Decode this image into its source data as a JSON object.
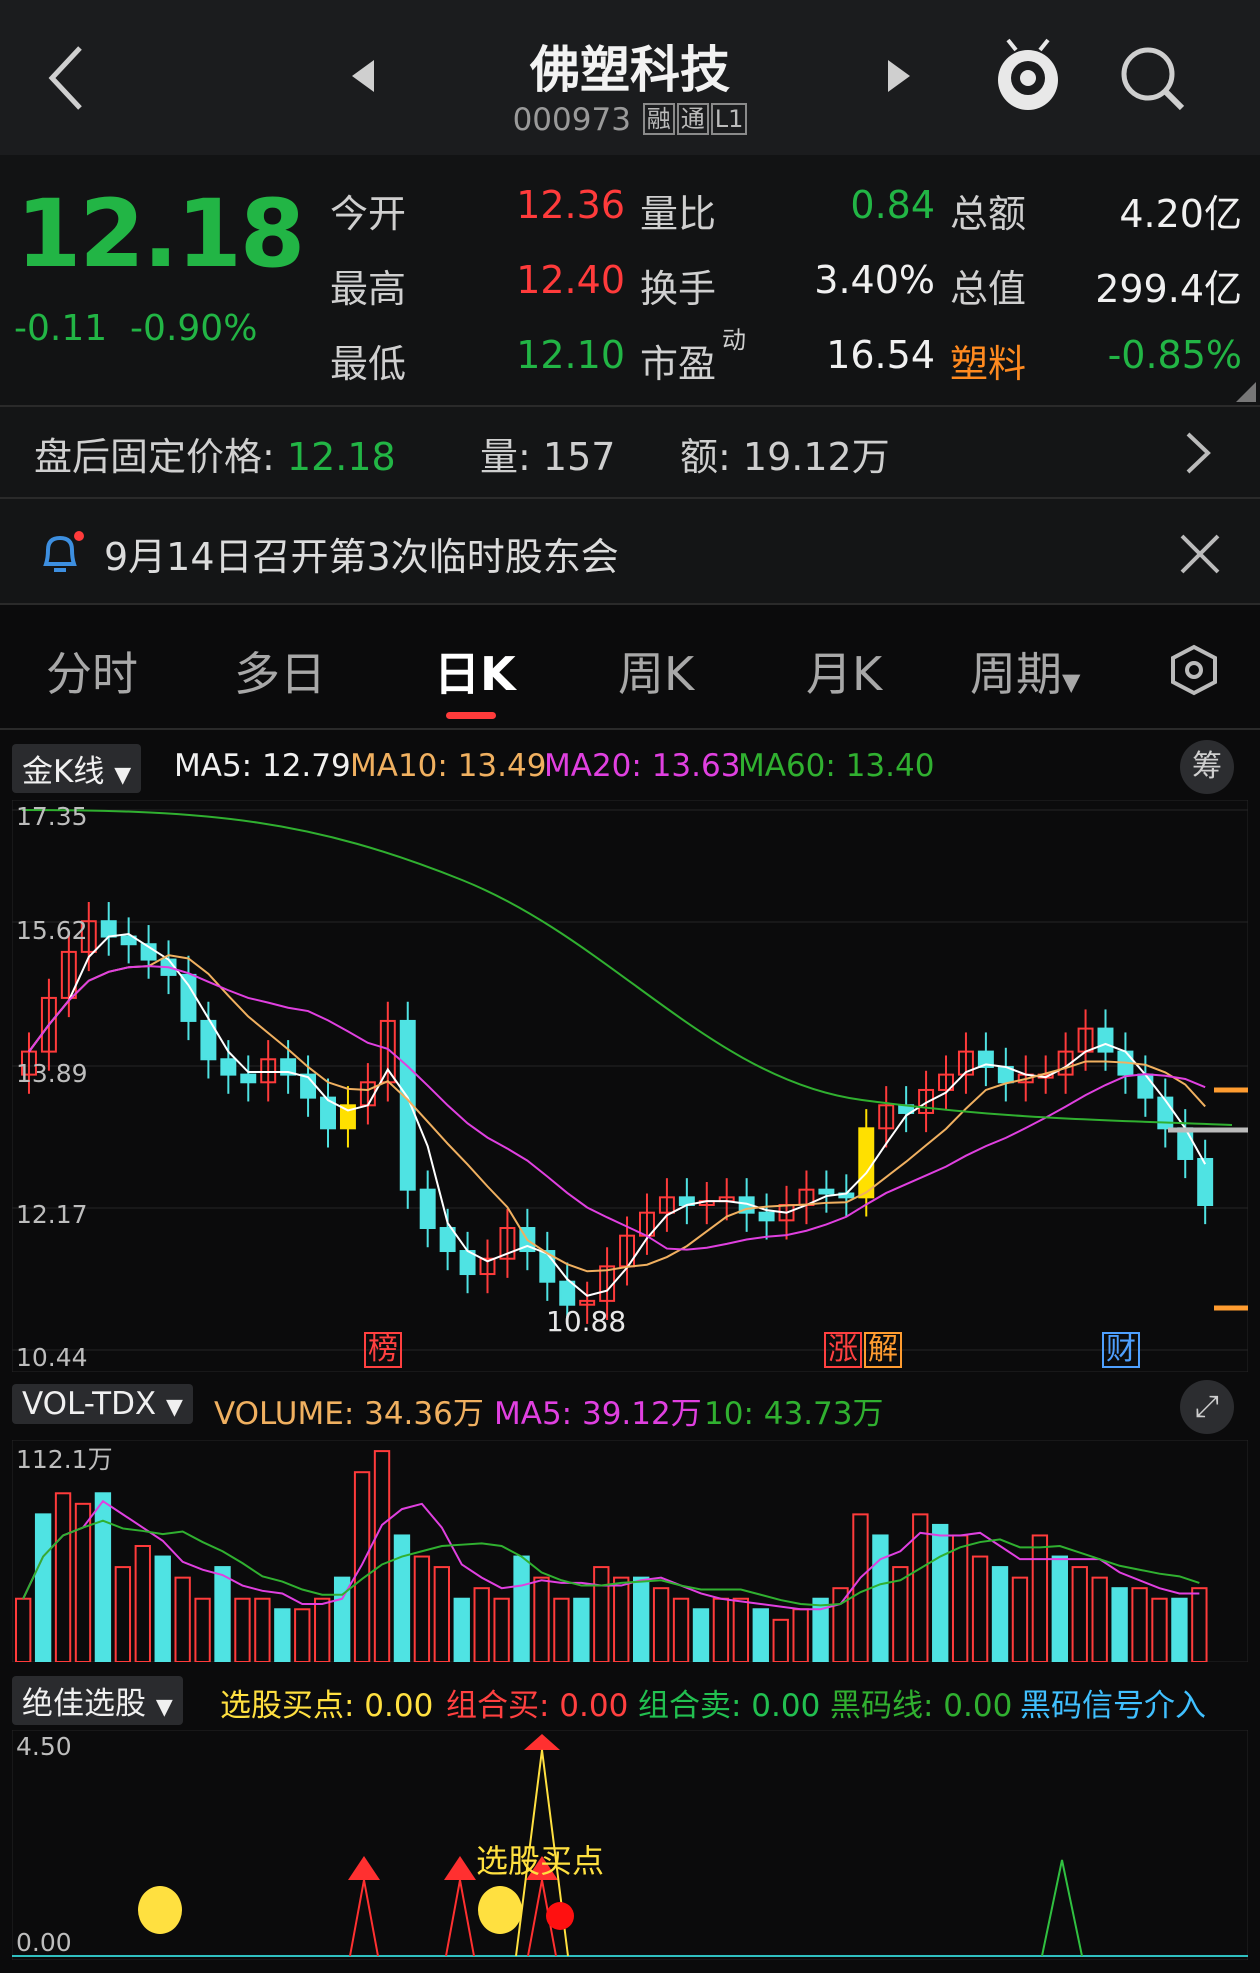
{
  "header": {
    "title": "佛塑科技",
    "code": "000973",
    "tags": [
      "融",
      "通",
      "L1"
    ]
  },
  "quote": {
    "price": "12.18",
    "change": "-0.11",
    "change_pct": "-0.90%",
    "rows": [
      {
        "l1": "今开",
        "v1": "12.36",
        "c1": "red",
        "l2": "量比",
        "v2": "0.84",
        "c2": "green",
        "l3": "总额",
        "v3": "4.20亿",
        "c3": "white"
      },
      {
        "l1": "最高",
        "v1": "12.40",
        "c1": "red",
        "l2": "换手",
        "v2": "3.40%",
        "c2": "white",
        "l3": "总值",
        "v3": "299.4亿",
        "c3": "white"
      },
      {
        "l1": "最低",
        "v1": "12.10",
        "c1": "green",
        "l2": "市盈",
        "v2": "16.54",
        "c2": "white",
        "l3": "塑料",
        "v3": "-0.85%",
        "c3": "green"
      }
    ],
    "pe_sup": "动"
  },
  "after_hours": {
    "label": "盘后固定价格:",
    "price": "12.18",
    "vol_label": "量:",
    "vol": "157",
    "amt_label": "额:",
    "amt": "19.12万"
  },
  "notice": {
    "text": "9月14日召开第3次临时股东会"
  },
  "tabs": [
    "分时",
    "多日",
    "日K",
    "周K",
    "月K",
    "周期"
  ],
  "kline": {
    "selector": "金K线",
    "chip": "筹",
    "ma5": "MA5: 12.79",
    "ma10": "MA10: 13.49",
    "ma20": "MA20: 13.63",
    "ma60": "MA60: 13.40",
    "axis": [
      "17.35",
      "15.62",
      "13.89",
      "12.17",
      "10.44"
    ],
    "low_label": "10.88",
    "marks": [
      "榜",
      "涨",
      "解",
      "财"
    ]
  },
  "volume": {
    "selector": "VOL-TDX",
    "v": "VOLUME: 34.36万",
    "ma5": "MA5: 39.12万",
    "ma10": "10: 43.73万",
    "axis_top": "112.1万"
  },
  "signal": {
    "selector": "绝佳选股",
    "buy": "选股买点: 0.00",
    "cbuy": "组合买: 0.00",
    "csell": "组合卖: 0.00",
    "black": "黑码线: 0.00",
    "hint": "黑码信号介入",
    "axis_top": "4.50",
    "axis_bot": "0.00",
    "annot": "选股买点"
  },
  "colors": {
    "up": "#ff3b3b",
    "down": "#22b545",
    "candle_down": "#4fe3e3",
    "ma5": "#ffffff",
    "ma10": "#f0b060",
    "ma20": "#e040e0",
    "ma60": "#30b030"
  }
}
